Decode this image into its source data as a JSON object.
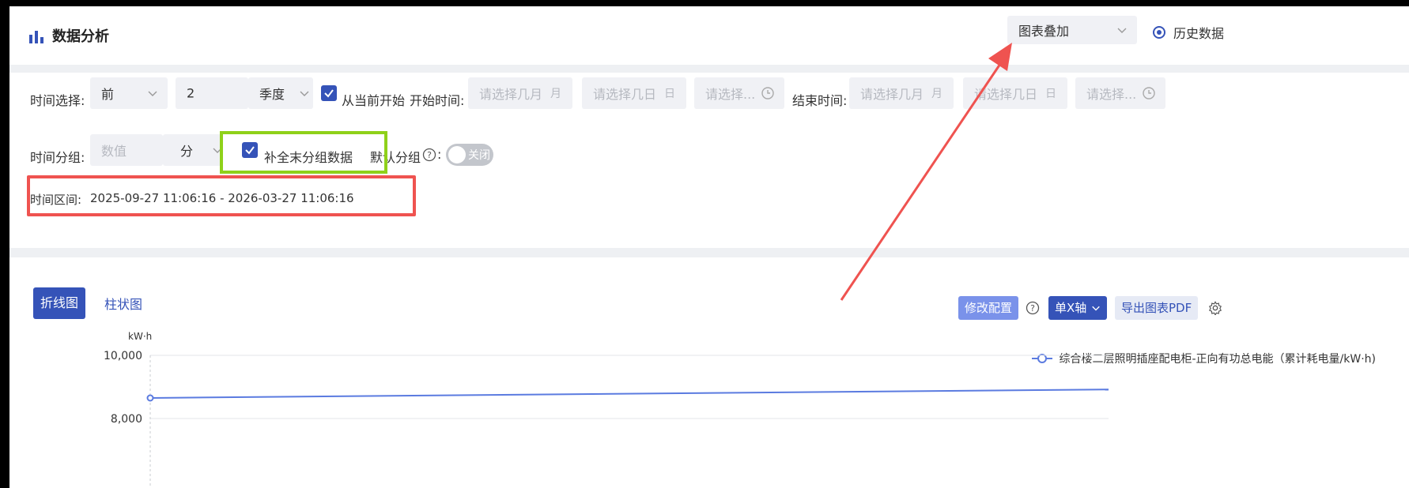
{
  "header": {
    "title": "数据分析",
    "overlay_select": "图表叠加",
    "history_radio": "历史数据"
  },
  "filter": {
    "time_select_label": "时间选择:",
    "direction": "前",
    "count": "2",
    "period_unit": "季度",
    "from_now_label": "从当前开始",
    "start_time_label": "开始时间:",
    "month_placeholder": "请选择几月",
    "month_unit": "月",
    "day_placeholder": "请选择几日",
    "day_unit": "日",
    "time_placeholder": "请选择...",
    "end_time_label": "结束时间:",
    "group_label": "时间分组:",
    "group_value_placeholder": "数值",
    "group_unit": "分",
    "fill_last_label": "补全末分组数据",
    "default_group_label": "默认分组",
    "colon": ":",
    "switch_text": "关闭",
    "range_label": "时间区间:",
    "range_value": "2025-09-27 11:06:16 - 2026-03-27 11:06:16"
  },
  "chart_panel": {
    "tab_line": "折线图",
    "tab_bar": "柱状图",
    "btn_config": "修改配置",
    "btn_axis": "单X轴",
    "btn_export": "导出图表PDF",
    "legend_label": "综合楼二层照明插座配电柜-正向有功总电能（累计耗电量/kW·h)"
  },
  "colors": {
    "primary": "#3553b8",
    "line": "#5b7be0",
    "annotation_red": "#ef5350",
    "annotation_green": "#8fd11a"
  },
  "chart_data": {
    "type": "line",
    "ylabel": "kW·h",
    "y_ticks": [
      "10,000",
      "8,000"
    ],
    "ylim": [
      8000,
      10000
    ],
    "series": [
      {
        "name": "综合楼二层照明插座配电柜-正向有功总电能（累计耗电量/kW·h)",
        "x": [
          0,
          1
        ],
        "values": [
          8650,
          8920
        ]
      }
    ]
  }
}
